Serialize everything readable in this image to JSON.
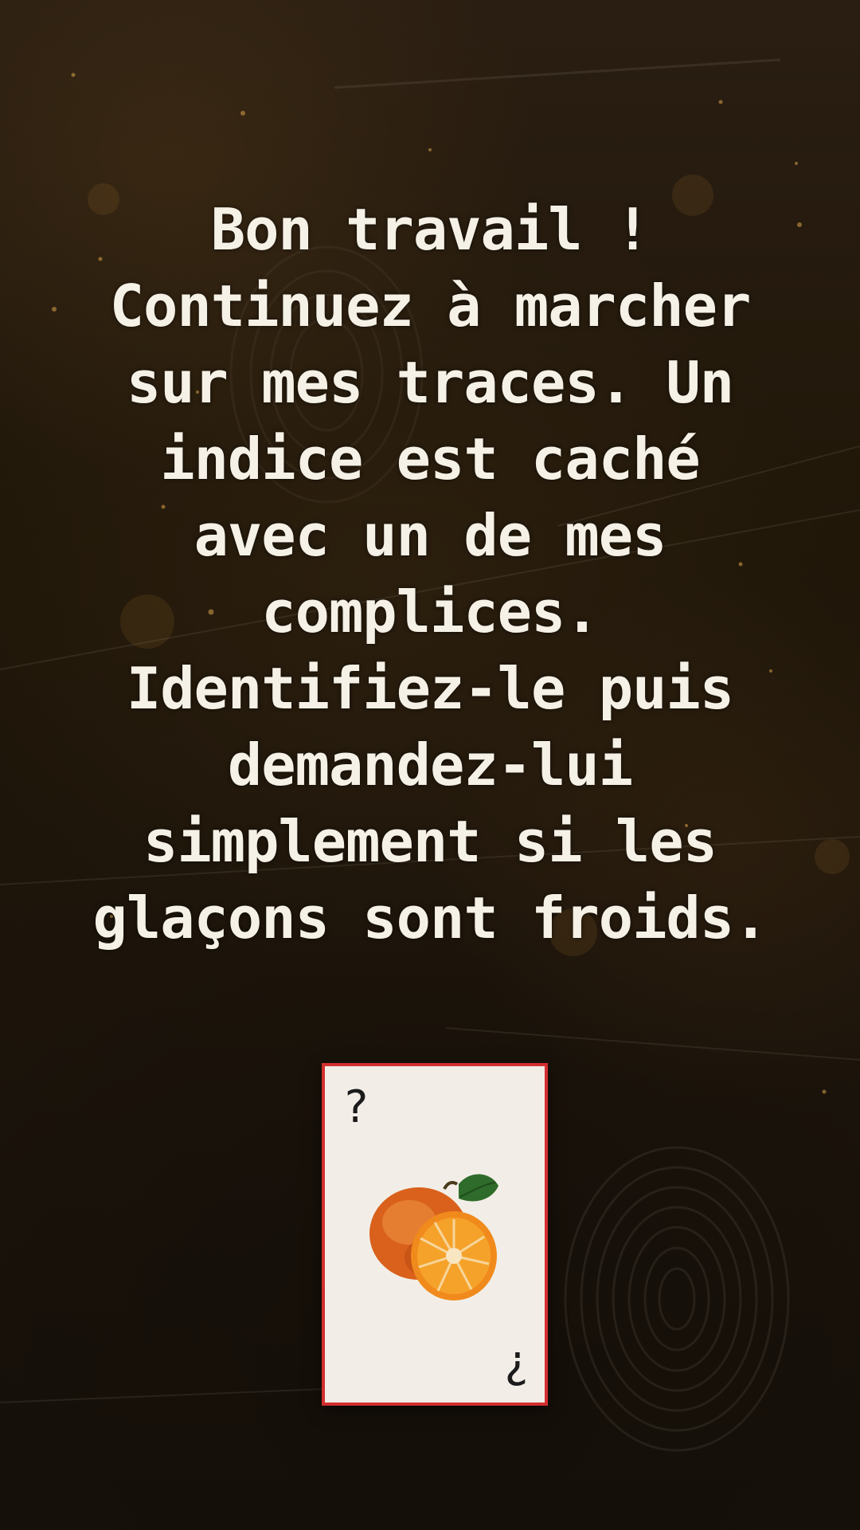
{
  "message": {
    "lines": [
      "Bon travail !",
      "Continuez à marcher",
      "sur mes traces. Un",
      "indice est caché",
      "avec un de mes",
      "complices.",
      "Identifiez-le puis",
      "demandez-lui",
      "simplement si les",
      "glaçons sont froids."
    ]
  },
  "card": {
    "top_symbol": "?",
    "bottom_symbol": "¿",
    "image_icon": "orange-fruit-icon",
    "border_color": "#d32f2f"
  },
  "colors": {
    "text": "#f6f1e6",
    "background": "#1f160d"
  }
}
